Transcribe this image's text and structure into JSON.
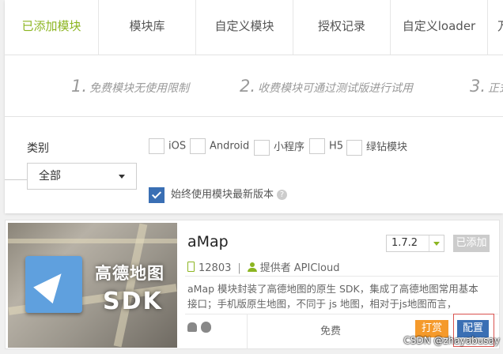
{
  "tabs": [
    {
      "label": "已添加模块",
      "active": true
    },
    {
      "label": "模块库"
    },
    {
      "label": "自定义模块"
    },
    {
      "label": "授权记录"
    },
    {
      "label": "自定义loader"
    },
    {
      "label": "万"
    }
  ],
  "notices": [
    {
      "num": "1.",
      "text": "免费模块无使用限制"
    },
    {
      "num": "2.",
      "text": "收费模块可通过测试版进行试用"
    },
    {
      "num": "3.",
      "text": "正式"
    }
  ],
  "filter": {
    "category_label": "类别",
    "options": [
      "iOS",
      "Android",
      "小程序",
      "H5",
      "绿钻模块"
    ],
    "select_value": "全部",
    "latest_label": "始终使用模块最新版本"
  },
  "module": {
    "image_title": "高德地图",
    "image_sub": "SDK",
    "name": "aMap",
    "version": "1.7.2",
    "added_label": "已添加",
    "downloads": "12803",
    "provider_label": "提供者",
    "provider": "APICloud",
    "description": "aMap 模块封装了高德地图的原生 SDK，集成了高德地图常用基本接口；手机版原生地图，不同于 js 地图，相对于js地图而言，",
    "price": "免费",
    "tip_label": "打赏",
    "config_label": "配置"
  },
  "watermark": "CSDN @zhayabusay",
  "colors": {
    "accent": "#8cb521",
    "primary": "#3a6fb4",
    "tip": "#f59a2b"
  }
}
